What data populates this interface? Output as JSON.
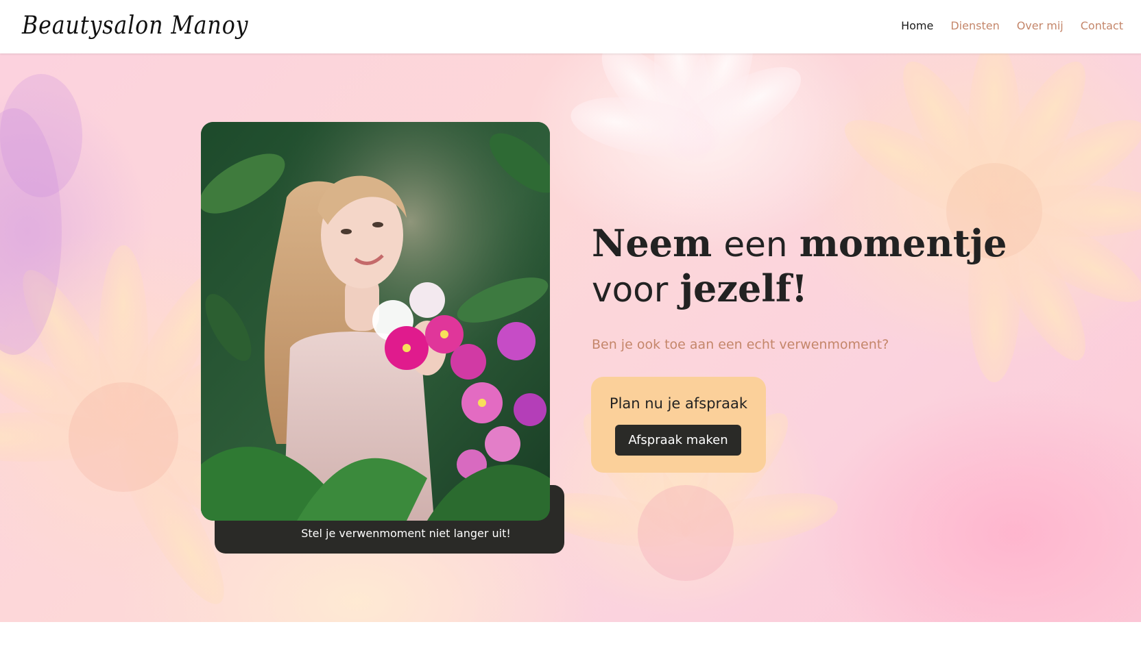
{
  "header": {
    "logo_text": "Beautysalon Manoy",
    "nav": [
      {
        "label": "Home",
        "active": true
      },
      {
        "label": "Diensten",
        "active": false
      },
      {
        "label": "Over mij",
        "active": false
      },
      {
        "label": "Contact",
        "active": false
      }
    ]
  },
  "hero": {
    "headline": {
      "w1": "Neem",
      "w2": "een",
      "w3": "momentje",
      "w4": "voor",
      "w5": "jezelf!"
    },
    "subline": "Ben je ook toe aan een echt verwenmoment?",
    "photo_caption": "Stel je verwenmoment niet langer uit!",
    "cta": {
      "title": "Plan nu je afspraak",
      "button_label": "Afspraak maken"
    }
  },
  "colors": {
    "accent": "#c4866a",
    "dark": "#2a2a27",
    "cta_background": "#fbd09a",
    "hero_pink": "#fcd2de"
  },
  "icons": {
    "background": "flower-pattern",
    "photo": "woman-with-orchids-photo"
  }
}
